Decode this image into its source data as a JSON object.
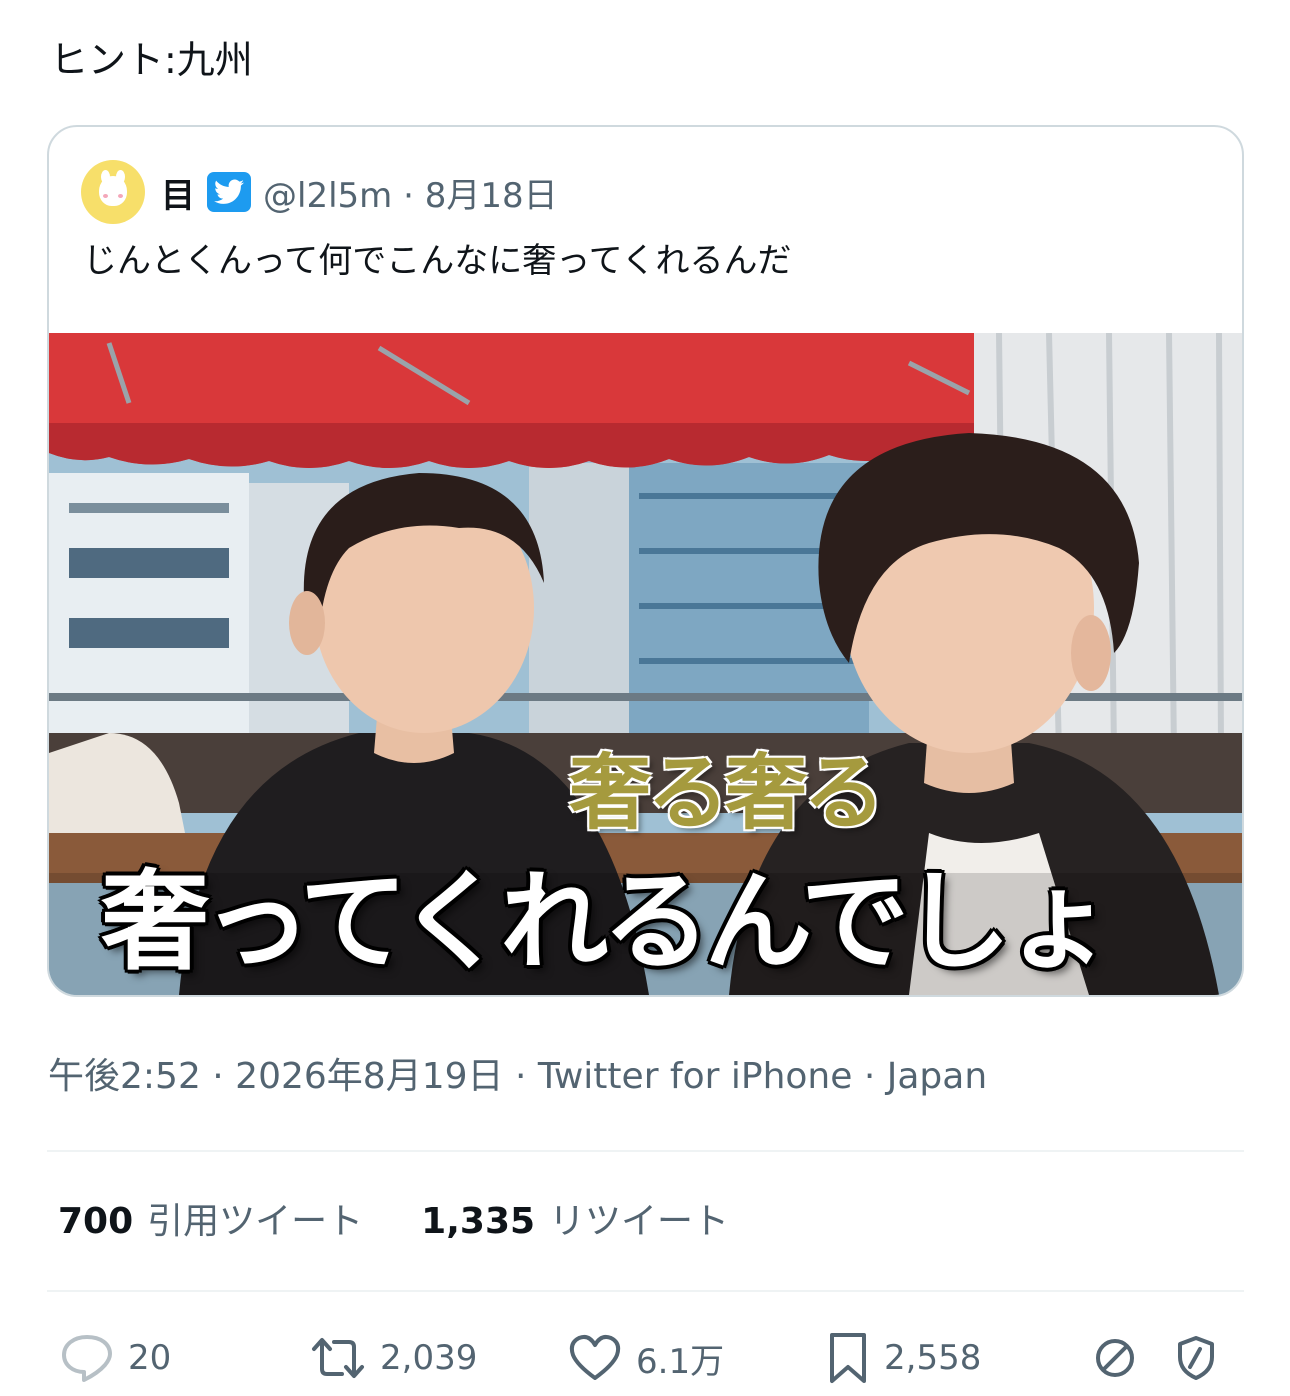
{
  "tweet": {
    "text": "ヒント:九州"
  },
  "quoted_tweet": {
    "author_name": "目",
    "handle_date": "@l2l5m · 8月18日",
    "text": "じんとくんって何でこんなに奢ってくれるんだ",
    "media": {
      "caption_top": "奢る奢る",
      "caption_main": "奢ってくれるんでしょ"
    }
  },
  "meta": {
    "line": "午後2:52 · 2026年8月19日 · Twitter for iPhone · Japan"
  },
  "stats": {
    "quote_count": "700",
    "quote_label": "引用ツイート",
    "retweet_count": "1,335",
    "retweet_label": "リツイート"
  },
  "actions": {
    "replies": "20",
    "retweets": "2,039",
    "likes": "6.1万",
    "bookmarks": "2,558",
    "icons": [
      "reply-icon",
      "retweet-icon",
      "like-icon",
      "bookmark-icon",
      "block-icon",
      "shield-icon"
    ]
  },
  "colors": {
    "text": "#0f1419",
    "secondary": "#536471",
    "border": "#cfd9de",
    "verified": "#1d9bf0"
  }
}
